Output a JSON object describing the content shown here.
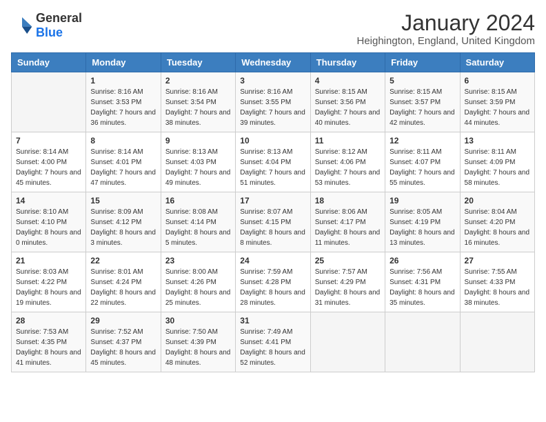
{
  "logo": {
    "general": "General",
    "blue": "Blue"
  },
  "header": {
    "title": "January 2024",
    "subtitle": "Heighington, England, United Kingdom"
  },
  "weekdays": [
    "Sunday",
    "Monday",
    "Tuesday",
    "Wednesday",
    "Thursday",
    "Friday",
    "Saturday"
  ],
  "weeks": [
    [
      {
        "day": "",
        "sunrise": "",
        "sunset": "",
        "daylight": "",
        "empty": true
      },
      {
        "day": "1",
        "sunrise": "Sunrise: 8:16 AM",
        "sunset": "Sunset: 3:53 PM",
        "daylight": "Daylight: 7 hours and 36 minutes."
      },
      {
        "day": "2",
        "sunrise": "Sunrise: 8:16 AM",
        "sunset": "Sunset: 3:54 PM",
        "daylight": "Daylight: 7 hours and 38 minutes."
      },
      {
        "day": "3",
        "sunrise": "Sunrise: 8:16 AM",
        "sunset": "Sunset: 3:55 PM",
        "daylight": "Daylight: 7 hours and 39 minutes."
      },
      {
        "day": "4",
        "sunrise": "Sunrise: 8:15 AM",
        "sunset": "Sunset: 3:56 PM",
        "daylight": "Daylight: 7 hours and 40 minutes."
      },
      {
        "day": "5",
        "sunrise": "Sunrise: 8:15 AM",
        "sunset": "Sunset: 3:57 PM",
        "daylight": "Daylight: 7 hours and 42 minutes."
      },
      {
        "day": "6",
        "sunrise": "Sunrise: 8:15 AM",
        "sunset": "Sunset: 3:59 PM",
        "daylight": "Daylight: 7 hours and 44 minutes."
      }
    ],
    [
      {
        "day": "7",
        "sunrise": "Sunrise: 8:14 AM",
        "sunset": "Sunset: 4:00 PM",
        "daylight": "Daylight: 7 hours and 45 minutes."
      },
      {
        "day": "8",
        "sunrise": "Sunrise: 8:14 AM",
        "sunset": "Sunset: 4:01 PM",
        "daylight": "Daylight: 7 hours and 47 minutes."
      },
      {
        "day": "9",
        "sunrise": "Sunrise: 8:13 AM",
        "sunset": "Sunset: 4:03 PM",
        "daylight": "Daylight: 7 hours and 49 minutes."
      },
      {
        "day": "10",
        "sunrise": "Sunrise: 8:13 AM",
        "sunset": "Sunset: 4:04 PM",
        "daylight": "Daylight: 7 hours and 51 minutes."
      },
      {
        "day": "11",
        "sunrise": "Sunrise: 8:12 AM",
        "sunset": "Sunset: 4:06 PM",
        "daylight": "Daylight: 7 hours and 53 minutes."
      },
      {
        "day": "12",
        "sunrise": "Sunrise: 8:11 AM",
        "sunset": "Sunset: 4:07 PM",
        "daylight": "Daylight: 7 hours and 55 minutes."
      },
      {
        "day": "13",
        "sunrise": "Sunrise: 8:11 AM",
        "sunset": "Sunset: 4:09 PM",
        "daylight": "Daylight: 7 hours and 58 minutes."
      }
    ],
    [
      {
        "day": "14",
        "sunrise": "Sunrise: 8:10 AM",
        "sunset": "Sunset: 4:10 PM",
        "daylight": "Daylight: 8 hours and 0 minutes."
      },
      {
        "day": "15",
        "sunrise": "Sunrise: 8:09 AM",
        "sunset": "Sunset: 4:12 PM",
        "daylight": "Daylight: 8 hours and 3 minutes."
      },
      {
        "day": "16",
        "sunrise": "Sunrise: 8:08 AM",
        "sunset": "Sunset: 4:14 PM",
        "daylight": "Daylight: 8 hours and 5 minutes."
      },
      {
        "day": "17",
        "sunrise": "Sunrise: 8:07 AM",
        "sunset": "Sunset: 4:15 PM",
        "daylight": "Daylight: 8 hours and 8 minutes."
      },
      {
        "day": "18",
        "sunrise": "Sunrise: 8:06 AM",
        "sunset": "Sunset: 4:17 PM",
        "daylight": "Daylight: 8 hours and 11 minutes."
      },
      {
        "day": "19",
        "sunrise": "Sunrise: 8:05 AM",
        "sunset": "Sunset: 4:19 PM",
        "daylight": "Daylight: 8 hours and 13 minutes."
      },
      {
        "day": "20",
        "sunrise": "Sunrise: 8:04 AM",
        "sunset": "Sunset: 4:20 PM",
        "daylight": "Daylight: 8 hours and 16 minutes."
      }
    ],
    [
      {
        "day": "21",
        "sunrise": "Sunrise: 8:03 AM",
        "sunset": "Sunset: 4:22 PM",
        "daylight": "Daylight: 8 hours and 19 minutes."
      },
      {
        "day": "22",
        "sunrise": "Sunrise: 8:01 AM",
        "sunset": "Sunset: 4:24 PM",
        "daylight": "Daylight: 8 hours and 22 minutes."
      },
      {
        "day": "23",
        "sunrise": "Sunrise: 8:00 AM",
        "sunset": "Sunset: 4:26 PM",
        "daylight": "Daylight: 8 hours and 25 minutes."
      },
      {
        "day": "24",
        "sunrise": "Sunrise: 7:59 AM",
        "sunset": "Sunset: 4:28 PM",
        "daylight": "Daylight: 8 hours and 28 minutes."
      },
      {
        "day": "25",
        "sunrise": "Sunrise: 7:57 AM",
        "sunset": "Sunset: 4:29 PM",
        "daylight": "Daylight: 8 hours and 31 minutes."
      },
      {
        "day": "26",
        "sunrise": "Sunrise: 7:56 AM",
        "sunset": "Sunset: 4:31 PM",
        "daylight": "Daylight: 8 hours and 35 minutes."
      },
      {
        "day": "27",
        "sunrise": "Sunrise: 7:55 AM",
        "sunset": "Sunset: 4:33 PM",
        "daylight": "Daylight: 8 hours and 38 minutes."
      }
    ],
    [
      {
        "day": "28",
        "sunrise": "Sunrise: 7:53 AM",
        "sunset": "Sunset: 4:35 PM",
        "daylight": "Daylight: 8 hours and 41 minutes."
      },
      {
        "day": "29",
        "sunrise": "Sunrise: 7:52 AM",
        "sunset": "Sunset: 4:37 PM",
        "daylight": "Daylight: 8 hours and 45 minutes."
      },
      {
        "day": "30",
        "sunrise": "Sunrise: 7:50 AM",
        "sunset": "Sunset: 4:39 PM",
        "daylight": "Daylight: 8 hours and 48 minutes."
      },
      {
        "day": "31",
        "sunrise": "Sunrise: 7:49 AM",
        "sunset": "Sunset: 4:41 PM",
        "daylight": "Daylight: 8 hours and 52 minutes."
      },
      {
        "day": "",
        "sunrise": "",
        "sunset": "",
        "daylight": "",
        "empty": true
      },
      {
        "day": "",
        "sunrise": "",
        "sunset": "",
        "daylight": "",
        "empty": true
      },
      {
        "day": "",
        "sunrise": "",
        "sunset": "",
        "daylight": "",
        "empty": true
      }
    ]
  ]
}
